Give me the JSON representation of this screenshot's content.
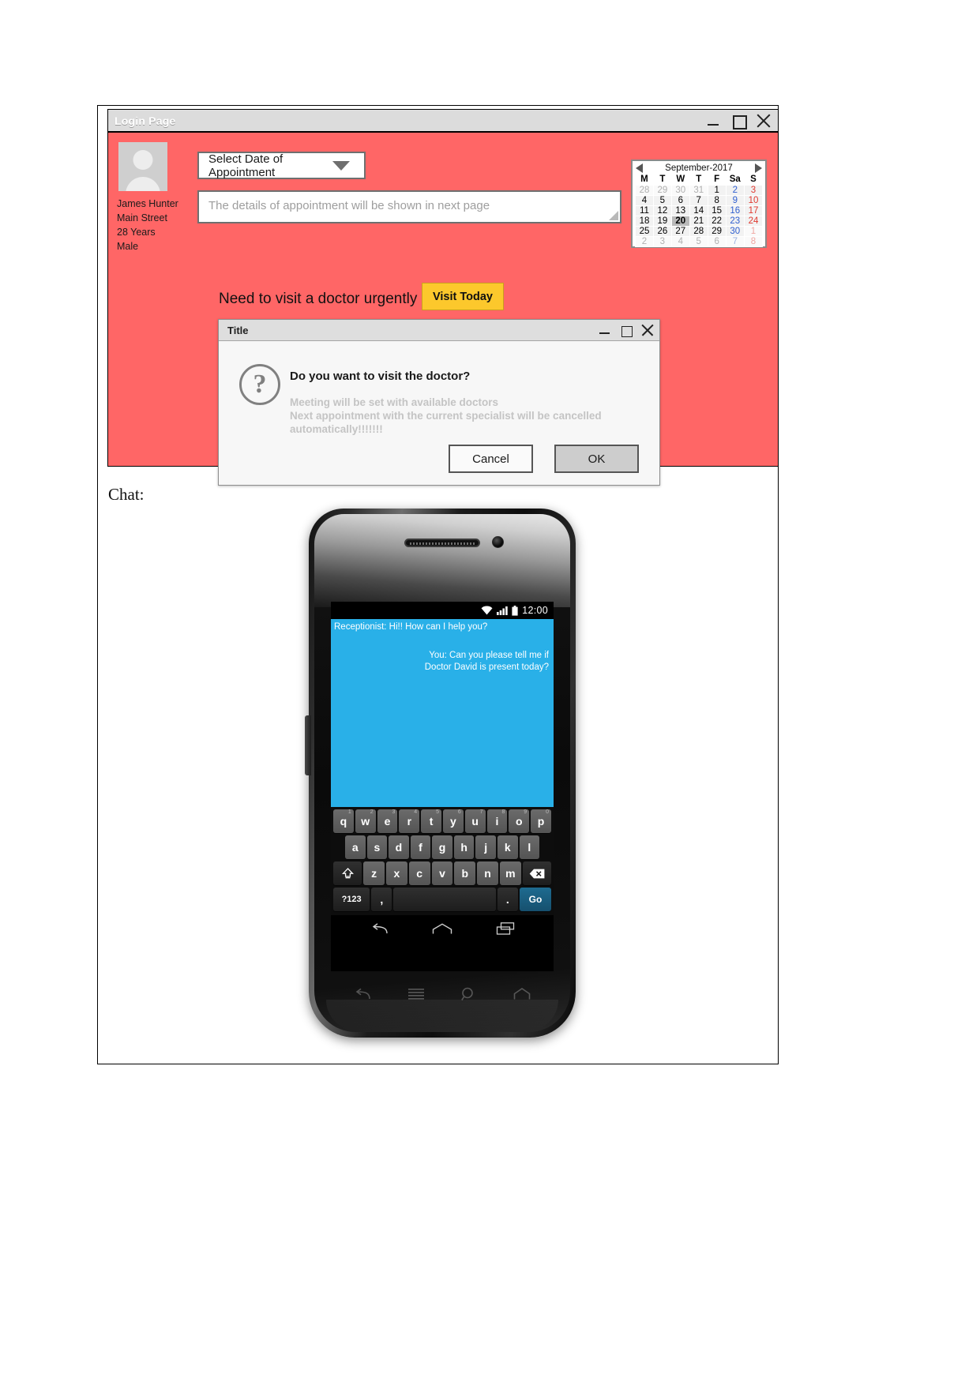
{
  "document": {
    "chat_label": "Chat:"
  },
  "login_window": {
    "title": "Login Page",
    "background_color": "#ff6666",
    "window_controls": {
      "minimize": "minimize-icon",
      "maximize": "maximize-icon",
      "close": "close-icon"
    },
    "profile": {
      "avatar": "user-avatar-placeholder",
      "name": "James Hunter",
      "address": "Main Street",
      "age": "28 Years",
      "gender": "Male"
    },
    "date_select": {
      "label": "Select Date of Appointment",
      "caret": "chevron-down-icon"
    },
    "details_textarea": {
      "placeholder": "The details of appointment will be shown in next page",
      "value": ""
    },
    "calendar": {
      "month_label": "September-2017",
      "prev_label": "prev-month",
      "next_label": "next-month",
      "weekdays": [
        "M",
        "T",
        "W",
        "T",
        "F",
        "Sa",
        "S"
      ],
      "selected_day": 20,
      "weeks": [
        [
          {
            "d": "28",
            "other": true
          },
          {
            "d": "29",
            "other": true
          },
          {
            "d": "30",
            "other": true
          },
          {
            "d": "31",
            "other": true
          },
          {
            "d": "1"
          },
          {
            "d": "2",
            "kind": "sat"
          },
          {
            "d": "3",
            "kind": "sun"
          }
        ],
        [
          {
            "d": "4"
          },
          {
            "d": "5"
          },
          {
            "d": "6"
          },
          {
            "d": "7"
          },
          {
            "d": "8"
          },
          {
            "d": "9",
            "kind": "sat"
          },
          {
            "d": "10",
            "kind": "sun"
          }
        ],
        [
          {
            "d": "11"
          },
          {
            "d": "12"
          },
          {
            "d": "13"
          },
          {
            "d": "14"
          },
          {
            "d": "15"
          },
          {
            "d": "16",
            "kind": "sat"
          },
          {
            "d": "17",
            "kind": "sun"
          }
        ],
        [
          {
            "d": "18"
          },
          {
            "d": "19"
          },
          {
            "d": "20",
            "today": true
          },
          {
            "d": "21"
          },
          {
            "d": "22"
          },
          {
            "d": "23",
            "kind": "sat"
          },
          {
            "d": "24",
            "kind": "sun"
          }
        ],
        [
          {
            "d": "25"
          },
          {
            "d": "26"
          },
          {
            "d": "27"
          },
          {
            "d": "28"
          },
          {
            "d": "29"
          },
          {
            "d": "30",
            "kind": "sat"
          },
          {
            "d": "1",
            "kind": "sun",
            "other": true
          }
        ],
        [
          {
            "d": "2",
            "other": true
          },
          {
            "d": "3",
            "other": true
          },
          {
            "d": "4",
            "other": true
          },
          {
            "d": "5",
            "other": true
          },
          {
            "d": "6",
            "other": true
          },
          {
            "d": "7",
            "kind": "sat",
            "other": true
          },
          {
            "d": "8",
            "kind": "sun",
            "other": true
          }
        ]
      ]
    },
    "urgent": {
      "text": "Need to visit a doctor urgently",
      "button_label": "Visit Today",
      "button_color": "#fcc82c"
    }
  },
  "dialog": {
    "title": "Title",
    "icon": "question-mark-icon",
    "heading": "Do you want to visit the doctor?",
    "sub_line_1": "Meeting will be set with available doctors",
    "sub_line_2": "Next appointment with the current specialist will be cancelled",
    "sub_line_3": "automatically!!!!!!!",
    "cancel_label": "Cancel",
    "ok_label": "OK",
    "window_controls": {
      "minimize": "minimize-icon",
      "maximize": "maximize-icon",
      "close": "close-icon"
    }
  },
  "phone": {
    "statusbar": {
      "wifi": "wifi-icon",
      "signal": "signal-bars-icon",
      "battery": "battery-icon",
      "clock": "12:00"
    },
    "chat": {
      "background_color": "#29b0e8",
      "messages": [
        {
          "from": "incoming",
          "text": "Receptionist: Hi!! How can I help you?"
        },
        {
          "from": "outgoing",
          "line1": "You: Can you please tell me if",
          "line2": "Doctor David is present today?"
        }
      ]
    },
    "keyboard": {
      "row1": [
        {
          "k": "q",
          "n": "1"
        },
        {
          "k": "w",
          "n": "2"
        },
        {
          "k": "e",
          "n": "3"
        },
        {
          "k": "r",
          "n": "4"
        },
        {
          "k": "t",
          "n": "5"
        },
        {
          "k": "y",
          "n": "6"
        },
        {
          "k": "u",
          "n": "7"
        },
        {
          "k": "i",
          "n": "8"
        },
        {
          "k": "o",
          "n": "9"
        },
        {
          "k": "p",
          "n": "0"
        }
      ],
      "row2": [
        "a",
        "s",
        "d",
        "f",
        "g",
        "h",
        "j",
        "k",
        "l"
      ],
      "row3": [
        "z",
        "x",
        "c",
        "v",
        "b",
        "n",
        "m"
      ],
      "shift_label": "shift-icon",
      "backspace_label": "backspace-icon",
      "symbols_label": "?123",
      "comma_label": ",",
      "space_label": "",
      "period_label": ".",
      "go_label": "Go"
    },
    "navbar": {
      "back": "back-icon",
      "home": "home-icon",
      "recents": "recent-apps-icon"
    },
    "capacitive": {
      "back": "back-icon",
      "menu": "menu-icon",
      "search": "search-icon",
      "home": "home-icon"
    }
  }
}
